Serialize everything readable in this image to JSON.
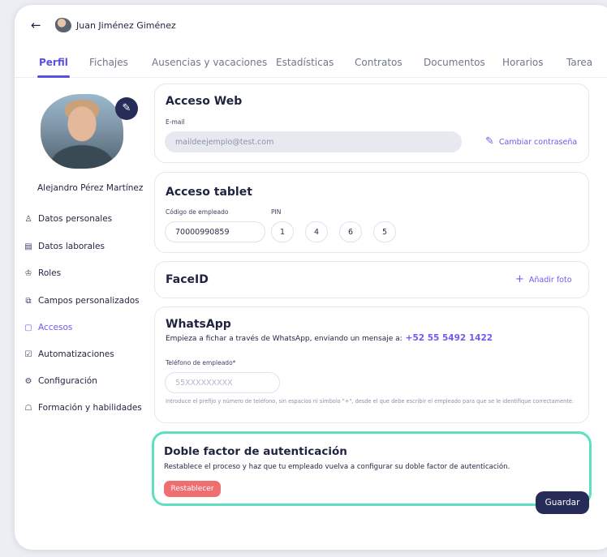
{
  "header": {
    "back_icon": "arrow-left-icon",
    "user_name": "Juan Jiménez Giménez"
  },
  "tabs": [
    {
      "label": "Perfil",
      "active": true
    },
    {
      "label": "Fichajes"
    },
    {
      "label": "Ausencias y vacaciones"
    },
    {
      "label": "Estadísticas"
    },
    {
      "label": "Contratos"
    },
    {
      "label": "Documentos"
    },
    {
      "label": "Horarios"
    },
    {
      "label": "Tarea"
    }
  ],
  "profile": {
    "name": "Alejandro Pérez Martínez",
    "edit_icon": "pencil-icon"
  },
  "menu": [
    {
      "label": "Datos personales",
      "icon": "person-icon"
    },
    {
      "label": "Datos laborales",
      "icon": "document-icon"
    },
    {
      "label": "Roles",
      "icon": "crown-icon"
    },
    {
      "label": "Campos personalizados",
      "icon": "fields-icon"
    },
    {
      "label": "Accesos",
      "icon": "key-icon",
      "active": true
    },
    {
      "label": "Automatizaciones",
      "icon": "checkbox-icon"
    },
    {
      "label": "Configuración",
      "icon": "gear-icon"
    },
    {
      "label": "Formación y habilidades",
      "icon": "graduation-icon"
    }
  ],
  "web_access": {
    "title": "Acceso Web",
    "email_label": "E-mail",
    "email_value": "maildeejemplo@test.com",
    "change_password": "Cambiar contraseña"
  },
  "tablet_access": {
    "title": "Acceso tablet",
    "employee_code_label": "Código de empleado",
    "employee_code": "70000990859",
    "pin_label": "PIN",
    "pin": [
      "1",
      "4",
      "6",
      "5"
    ]
  },
  "faceid": {
    "title": "FaceID",
    "add_photo": "Añadir foto"
  },
  "whatsapp": {
    "title": "WhatsApp",
    "text": "Empieza a fichar a través de WhatsApp, enviando un mensaje a:",
    "phone": "+52 55 5492 1422",
    "phone_label": "Teléfono de empleado*",
    "phone_placeholder": "55XXXXXXXXX",
    "hint": "Introduce el prefijo y número de teléfono, sin espacios ni símbolo \"+\", desde el que debe escribir el empleado para que se le identifique correctamente."
  },
  "two_factor": {
    "title": "Doble factor de autenticación",
    "text": "Restablece el proceso y haz que tu empleado vuelva a configurar su doble factor de autenticación.",
    "reset_button": "Restablecer"
  },
  "save_button": "Guardar",
  "colors": {
    "accent": "#5b4ee0",
    "highlight": "#5ee0c0",
    "danger": "#ef6f70",
    "dark": "#262b57"
  }
}
